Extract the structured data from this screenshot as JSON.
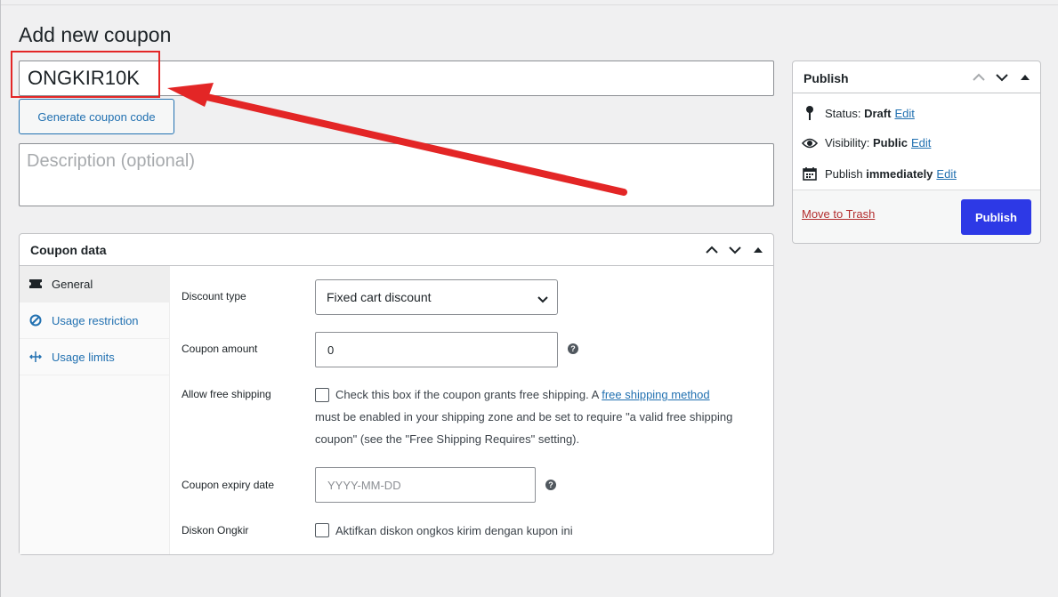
{
  "page": {
    "title": "Add new coupon"
  },
  "coupon": {
    "code": "ONGKIR10K",
    "generate_label": "Generate coupon code",
    "description_placeholder": "Description (optional)"
  },
  "coupon_data": {
    "title": "Coupon data",
    "tabs": [
      {
        "label": "General",
        "icon": "ticket-icon"
      },
      {
        "label": "Usage restriction",
        "icon": "ban-icon"
      },
      {
        "label": "Usage limits",
        "icon": "limits-icon"
      }
    ],
    "discount_type": {
      "label": "Discount type",
      "value": "Fixed cart discount"
    },
    "coupon_amount": {
      "label": "Coupon amount",
      "value": "0"
    },
    "free_shipping": {
      "label": "Allow free shipping",
      "text_before": "Check this box if the coupon grants free shipping. A",
      "link": "free shipping method",
      "text_line2": "must be enabled in your shipping zone and be set to require \"a valid free shipping",
      "text_line3": "coupon\" (see the \"Free Shipping Requires\" setting)."
    },
    "expiry": {
      "label": "Coupon expiry date",
      "placeholder": "YYYY-MM-DD"
    },
    "diskon_ongkir": {
      "label": "Diskon Ongkir",
      "text": "Aktifkan diskon ongkos kirim dengan kupon ini"
    },
    "help_glyph": "?"
  },
  "publish": {
    "title": "Publish",
    "status_label": "Status:",
    "status_value": "Draft",
    "visibility_label": "Visibility:",
    "visibility_value": "Public",
    "schedule_label": "Publish",
    "schedule_value": "immediately",
    "edit_label": "Edit",
    "trash_label": "Move to Trash",
    "publish_button": "Publish"
  },
  "colors": {
    "accent": "#2271b1",
    "publish_button": "#2d39e6",
    "annotation": "#e32626",
    "trash": "#b32d2e"
  }
}
